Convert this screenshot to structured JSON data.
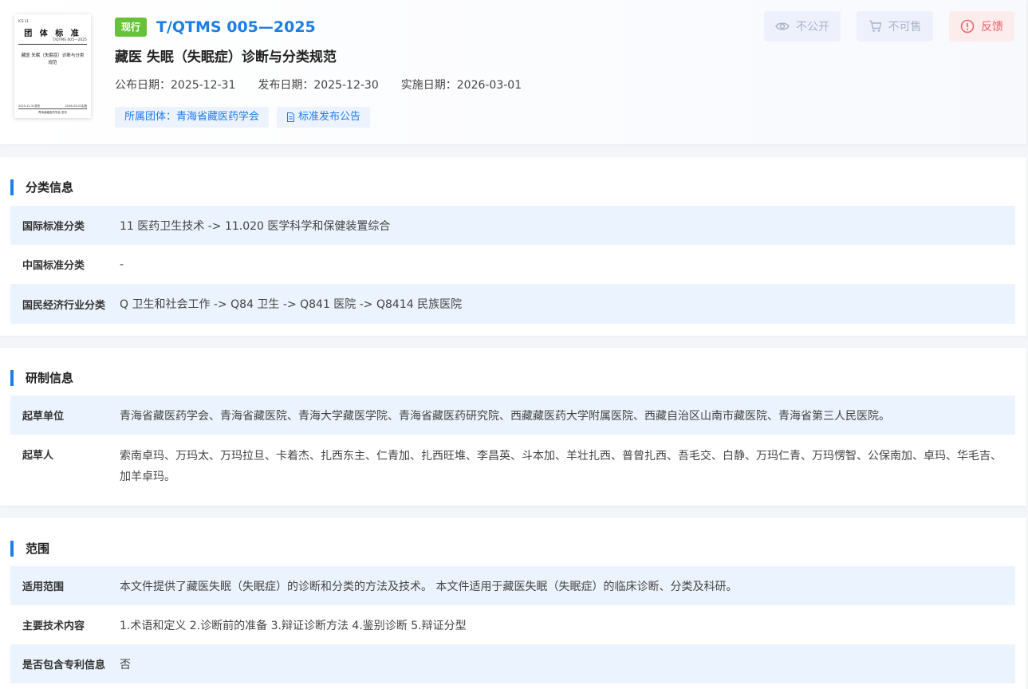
{
  "cover": {
    "ics": "ICS  11",
    "title": "团 体 标 准",
    "number": "T/QTMS 005—2025",
    "name": "藏医 失眠（失眠症）诊断与分类规范",
    "publish": "2025-12-31发布",
    "implement": "2026-03-01实施",
    "org": "青海省藏医药学会  发布"
  },
  "header": {
    "status": "现行",
    "code": "T/QTMS 005—2025",
    "name": "藏医 失眠（失眠症）诊断与分类规范",
    "dates": [
      "公布日期：2025-12-31",
      "发布日期：2025-12-30",
      "实施日期：2026-03-01"
    ],
    "tags": {
      "org": "所属团体：青海省藏医药学会",
      "notice": "标准发布公告"
    },
    "actions": {
      "private": "不公开",
      "nosale": "不可售",
      "feedback": "反馈"
    }
  },
  "classification": {
    "title": "分类信息",
    "rows": [
      {
        "label": "国际标准分类",
        "value": "11 医药卫生技术 -> 11.020 医学科学和保健装置综合"
      },
      {
        "label": "中国标准分类",
        "value": "-"
      },
      {
        "label": "国民经济行业分类",
        "value": "Q 卫生和社会工作 -> Q84 卫生 -> Q841 医院 -> Q8414 民族医院"
      }
    ]
  },
  "drafting": {
    "title": "研制信息",
    "rows": [
      {
        "label": "起草单位",
        "value": "青海省藏医药学会、青海省藏医院、青海大学藏医学院、青海省藏医药研究院、西藏藏医药大学附属医院、西藏自治区山南市藏医院、青海省第三人民医院。"
      },
      {
        "label": "起草人",
        "value": "索南卓玛、万玛太、万玛拉旦、卡着杰、扎西东主、仁青加、扎西旺堆、李昌英、斗本加、羊壮扎西、普曾扎西、吾毛交、白静、万玛仁青、万玛愣智、公保南加、卓玛、华毛吉、加羊卓玛。"
      }
    ]
  },
  "scope": {
    "title": "范围",
    "rows": [
      {
        "label": "适用范围",
        "value": "本文件提供了藏医失眠（失眠症）的诊断和分类的方法及技术。 本文件适用于藏医失眠（失眠症）的临床诊断、分类及科研。"
      },
      {
        "label": "主要技术内容",
        "value": "1.术语和定义 2.诊断前的准备 3.辩证诊断方法 4.鉴别诊断 5.辩证分型"
      },
      {
        "label": "是否包含专利信息",
        "value": "否"
      }
    ]
  }
}
